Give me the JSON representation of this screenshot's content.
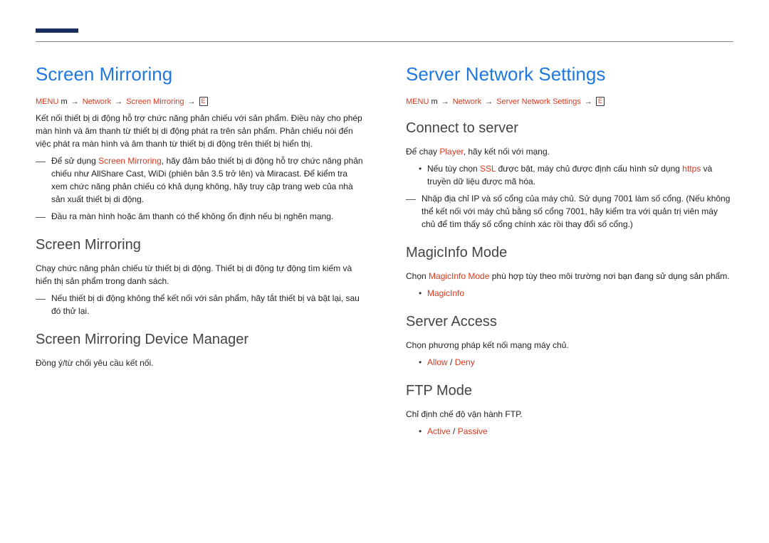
{
  "bc": {
    "menu": "MENU",
    "menubtn": "m",
    "arrow": "→",
    "net": "Network",
    "sm": "Screen Mirroring",
    "sns": "Server Network Settings",
    "enter": "E"
  },
  "left": {
    "h1": "Screen Mirroring",
    "intro": "Kết nối thiết bị di động hỗ trợ chức năng phản chiếu với sản phẩm. Điều này cho phép màn hình và âm thanh từ thiết bị di động phát ra trên sản phẩm. Phản chiếu nói đến việc phát ra màn hình và âm thanh từ thiết bị di động trên thiết bị hiển thị.",
    "notes": [
      {
        "pre": "Để sử dụng ",
        "kw": "Screen Mirroring",
        "post": ", hãy đảm bảo thiết bị di động hỗ trợ chức năng phản chiếu như AllShare Cast, WiDi (phiên bản 3.5 trở lên) và Miracast. Để kiểm tra xem chức năng phản chiếu có khả dụng không, hãy truy cập trang web của nhà sản xuất thiết bị di động."
      },
      {
        "pre": "",
        "kw": "",
        "post": "Đầu ra màn hình hoặc âm thanh có thể không ổn định nếu bị nghẽn mạng."
      }
    ],
    "sm": {
      "h": "Screen Mirroring",
      "p": "Chạy chức năng phản chiếu từ thiết bị di động. Thiết bị di động tự động tìm kiếm và hiển thị sản phẩm trong danh sách.",
      "note": "Nếu thiết bị di động không thể kết nối với sản phẩm, hãy tắt thiết bị và bật lại, sau đó thử lại."
    },
    "dm": {
      "h": "Screen Mirroring Device Manager",
      "p": "Đồng ý/từ chối yêu cầu kết nối."
    }
  },
  "right": {
    "h1": "Server Network Settings",
    "cts": {
      "h": "Connect to server",
      "p_pre": "Để chạy ",
      "p_kw": "Player",
      "p_post": ", hãy kết nối với mạng.",
      "bullet_pre": "Nếu tùy chọn ",
      "bullet_kw1": "SSL",
      "bullet_mid": " được bật, máy chủ được định cấu hình sử dụng ",
      "bullet_kw2": "https",
      "bullet_post": " và truyền dữ liệu được mã hóa.",
      "note": "Nhập địa chỉ IP và số cổng của máy chủ. Sử dụng 7001 làm số cổng. (Nếu không thể kết nối với máy chủ bằng số cổng 7001, hãy kiểm tra với quản trị viên máy chủ để tìm thấy số cổng chính xác rồi thay đổi số cổng.)"
    },
    "mim": {
      "h": "MagicInfo Mode",
      "p_pre": "Chọn ",
      "p_kw": "MagicInfo Mode",
      "p_post": " phù hợp tùy theo môi trường nơi bạn đang sử dụng sản phẩm.",
      "bullet": "MagicInfo"
    },
    "sa": {
      "h": "Server Access",
      "p": "Chọn phương pháp kết nối mạng máy chủ.",
      "b1": "Allow",
      "bsep": " / ",
      "b2": "Deny"
    },
    "ftp": {
      "h": "FTP Mode",
      "p": "Chỉ định chế độ vận hành FTP.",
      "b1": "Active",
      "bsep": " / ",
      "b2": "Passive"
    }
  }
}
